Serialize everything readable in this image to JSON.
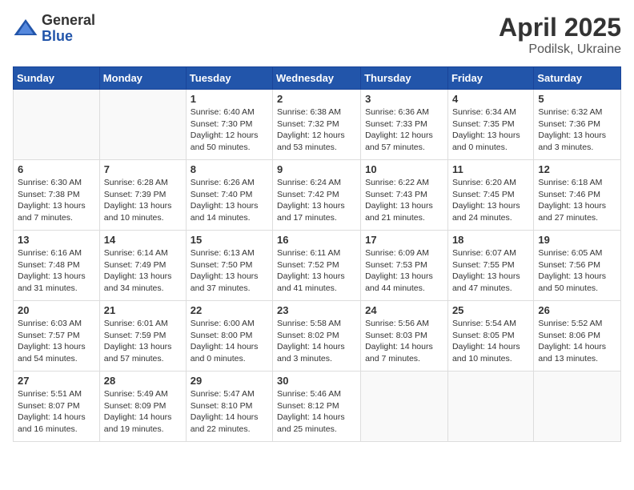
{
  "header": {
    "logo_general": "General",
    "logo_blue": "Blue",
    "month_title": "April 2025",
    "location": "Podilsk, Ukraine"
  },
  "days_of_week": [
    "Sunday",
    "Monday",
    "Tuesday",
    "Wednesday",
    "Thursday",
    "Friday",
    "Saturday"
  ],
  "weeks": [
    [
      {
        "day": "",
        "info": ""
      },
      {
        "day": "",
        "info": ""
      },
      {
        "day": "1",
        "info": "Sunrise: 6:40 AM\nSunset: 7:30 PM\nDaylight: 12 hours\nand 50 minutes."
      },
      {
        "day": "2",
        "info": "Sunrise: 6:38 AM\nSunset: 7:32 PM\nDaylight: 12 hours\nand 53 minutes."
      },
      {
        "day": "3",
        "info": "Sunrise: 6:36 AM\nSunset: 7:33 PM\nDaylight: 12 hours\nand 57 minutes."
      },
      {
        "day": "4",
        "info": "Sunrise: 6:34 AM\nSunset: 7:35 PM\nDaylight: 13 hours\nand 0 minutes."
      },
      {
        "day": "5",
        "info": "Sunrise: 6:32 AM\nSunset: 7:36 PM\nDaylight: 13 hours\nand 3 minutes."
      }
    ],
    [
      {
        "day": "6",
        "info": "Sunrise: 6:30 AM\nSunset: 7:38 PM\nDaylight: 13 hours\nand 7 minutes."
      },
      {
        "day": "7",
        "info": "Sunrise: 6:28 AM\nSunset: 7:39 PM\nDaylight: 13 hours\nand 10 minutes."
      },
      {
        "day": "8",
        "info": "Sunrise: 6:26 AM\nSunset: 7:40 PM\nDaylight: 13 hours\nand 14 minutes."
      },
      {
        "day": "9",
        "info": "Sunrise: 6:24 AM\nSunset: 7:42 PM\nDaylight: 13 hours\nand 17 minutes."
      },
      {
        "day": "10",
        "info": "Sunrise: 6:22 AM\nSunset: 7:43 PM\nDaylight: 13 hours\nand 21 minutes."
      },
      {
        "day": "11",
        "info": "Sunrise: 6:20 AM\nSunset: 7:45 PM\nDaylight: 13 hours\nand 24 minutes."
      },
      {
        "day": "12",
        "info": "Sunrise: 6:18 AM\nSunset: 7:46 PM\nDaylight: 13 hours\nand 27 minutes."
      }
    ],
    [
      {
        "day": "13",
        "info": "Sunrise: 6:16 AM\nSunset: 7:48 PM\nDaylight: 13 hours\nand 31 minutes."
      },
      {
        "day": "14",
        "info": "Sunrise: 6:14 AM\nSunset: 7:49 PM\nDaylight: 13 hours\nand 34 minutes."
      },
      {
        "day": "15",
        "info": "Sunrise: 6:13 AM\nSunset: 7:50 PM\nDaylight: 13 hours\nand 37 minutes."
      },
      {
        "day": "16",
        "info": "Sunrise: 6:11 AM\nSunset: 7:52 PM\nDaylight: 13 hours\nand 41 minutes."
      },
      {
        "day": "17",
        "info": "Sunrise: 6:09 AM\nSunset: 7:53 PM\nDaylight: 13 hours\nand 44 minutes."
      },
      {
        "day": "18",
        "info": "Sunrise: 6:07 AM\nSunset: 7:55 PM\nDaylight: 13 hours\nand 47 minutes."
      },
      {
        "day": "19",
        "info": "Sunrise: 6:05 AM\nSunset: 7:56 PM\nDaylight: 13 hours\nand 50 minutes."
      }
    ],
    [
      {
        "day": "20",
        "info": "Sunrise: 6:03 AM\nSunset: 7:57 PM\nDaylight: 13 hours\nand 54 minutes."
      },
      {
        "day": "21",
        "info": "Sunrise: 6:01 AM\nSunset: 7:59 PM\nDaylight: 13 hours\nand 57 minutes."
      },
      {
        "day": "22",
        "info": "Sunrise: 6:00 AM\nSunset: 8:00 PM\nDaylight: 14 hours\nand 0 minutes."
      },
      {
        "day": "23",
        "info": "Sunrise: 5:58 AM\nSunset: 8:02 PM\nDaylight: 14 hours\nand 3 minutes."
      },
      {
        "day": "24",
        "info": "Sunrise: 5:56 AM\nSunset: 8:03 PM\nDaylight: 14 hours\nand 7 minutes."
      },
      {
        "day": "25",
        "info": "Sunrise: 5:54 AM\nSunset: 8:05 PM\nDaylight: 14 hours\nand 10 minutes."
      },
      {
        "day": "26",
        "info": "Sunrise: 5:52 AM\nSunset: 8:06 PM\nDaylight: 14 hours\nand 13 minutes."
      }
    ],
    [
      {
        "day": "27",
        "info": "Sunrise: 5:51 AM\nSunset: 8:07 PM\nDaylight: 14 hours\nand 16 minutes."
      },
      {
        "day": "28",
        "info": "Sunrise: 5:49 AM\nSunset: 8:09 PM\nDaylight: 14 hours\nand 19 minutes."
      },
      {
        "day": "29",
        "info": "Sunrise: 5:47 AM\nSunset: 8:10 PM\nDaylight: 14 hours\nand 22 minutes."
      },
      {
        "day": "30",
        "info": "Sunrise: 5:46 AM\nSunset: 8:12 PM\nDaylight: 14 hours\nand 25 minutes."
      },
      {
        "day": "",
        "info": ""
      },
      {
        "day": "",
        "info": ""
      },
      {
        "day": "",
        "info": ""
      }
    ]
  ]
}
